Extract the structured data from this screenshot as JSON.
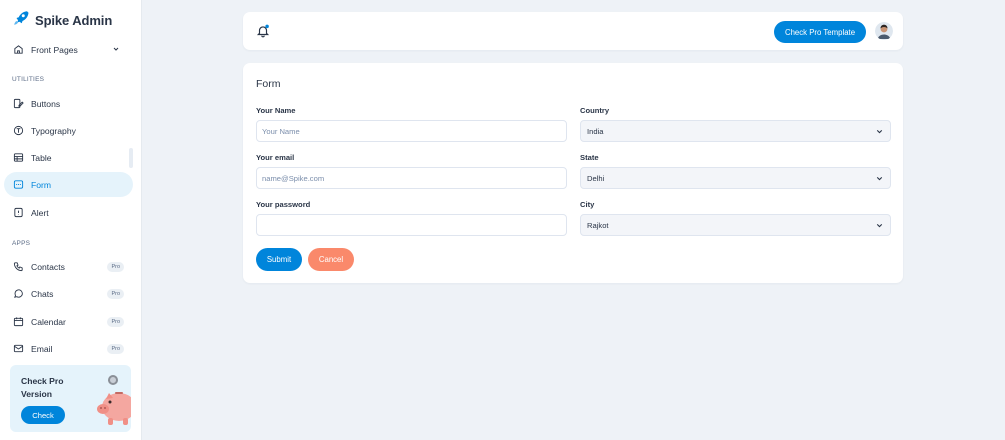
{
  "brand": {
    "name": "Spike Admin",
    "logo_icon": "rocket-icon"
  },
  "sidebar": {
    "front_pages": {
      "label": "Front Pages",
      "icon": "home-icon"
    },
    "utilities_label": "UTILITIES",
    "utilities": [
      {
        "label": "Buttons",
        "icon": "pencil-square-icon"
      },
      {
        "label": "Typography",
        "icon": "typography-icon"
      },
      {
        "label": "Table",
        "icon": "table-icon"
      },
      {
        "label": "Form",
        "icon": "form-icon",
        "active": true
      },
      {
        "label": "Alert",
        "icon": "alert-icon"
      }
    ],
    "apps_label": "APPS",
    "apps": [
      {
        "label": "Contacts",
        "icon": "phone-icon",
        "badge": "Pro"
      },
      {
        "label": "Chats",
        "icon": "chat-icon",
        "badge": "Pro"
      },
      {
        "label": "Calendar",
        "icon": "calendar-icon",
        "badge": "Pro"
      },
      {
        "label": "Email",
        "icon": "mail-icon",
        "badge": "Pro"
      }
    ],
    "promo": {
      "title": "Check Pro Version",
      "button": "Check"
    }
  },
  "topbar": {
    "pro_button": "Check Pro Template",
    "notification_dot": true
  },
  "form": {
    "title": "Form",
    "name_label": "Your Name",
    "name_placeholder": "Your Name",
    "email_label": "Your email",
    "email_placeholder": "name@Spike.com",
    "password_label": "Your password",
    "country_label": "Country",
    "country_value": "India",
    "state_label": "State",
    "state_value": "Delhi",
    "city_label": "City",
    "city_value": "Rajkot",
    "submit": "Submit",
    "cancel": "Cancel"
  },
  "colors": {
    "primary": "#0085db",
    "secondary": "#fa896b",
    "background": "#eef2f7",
    "text": "#2a3547"
  }
}
